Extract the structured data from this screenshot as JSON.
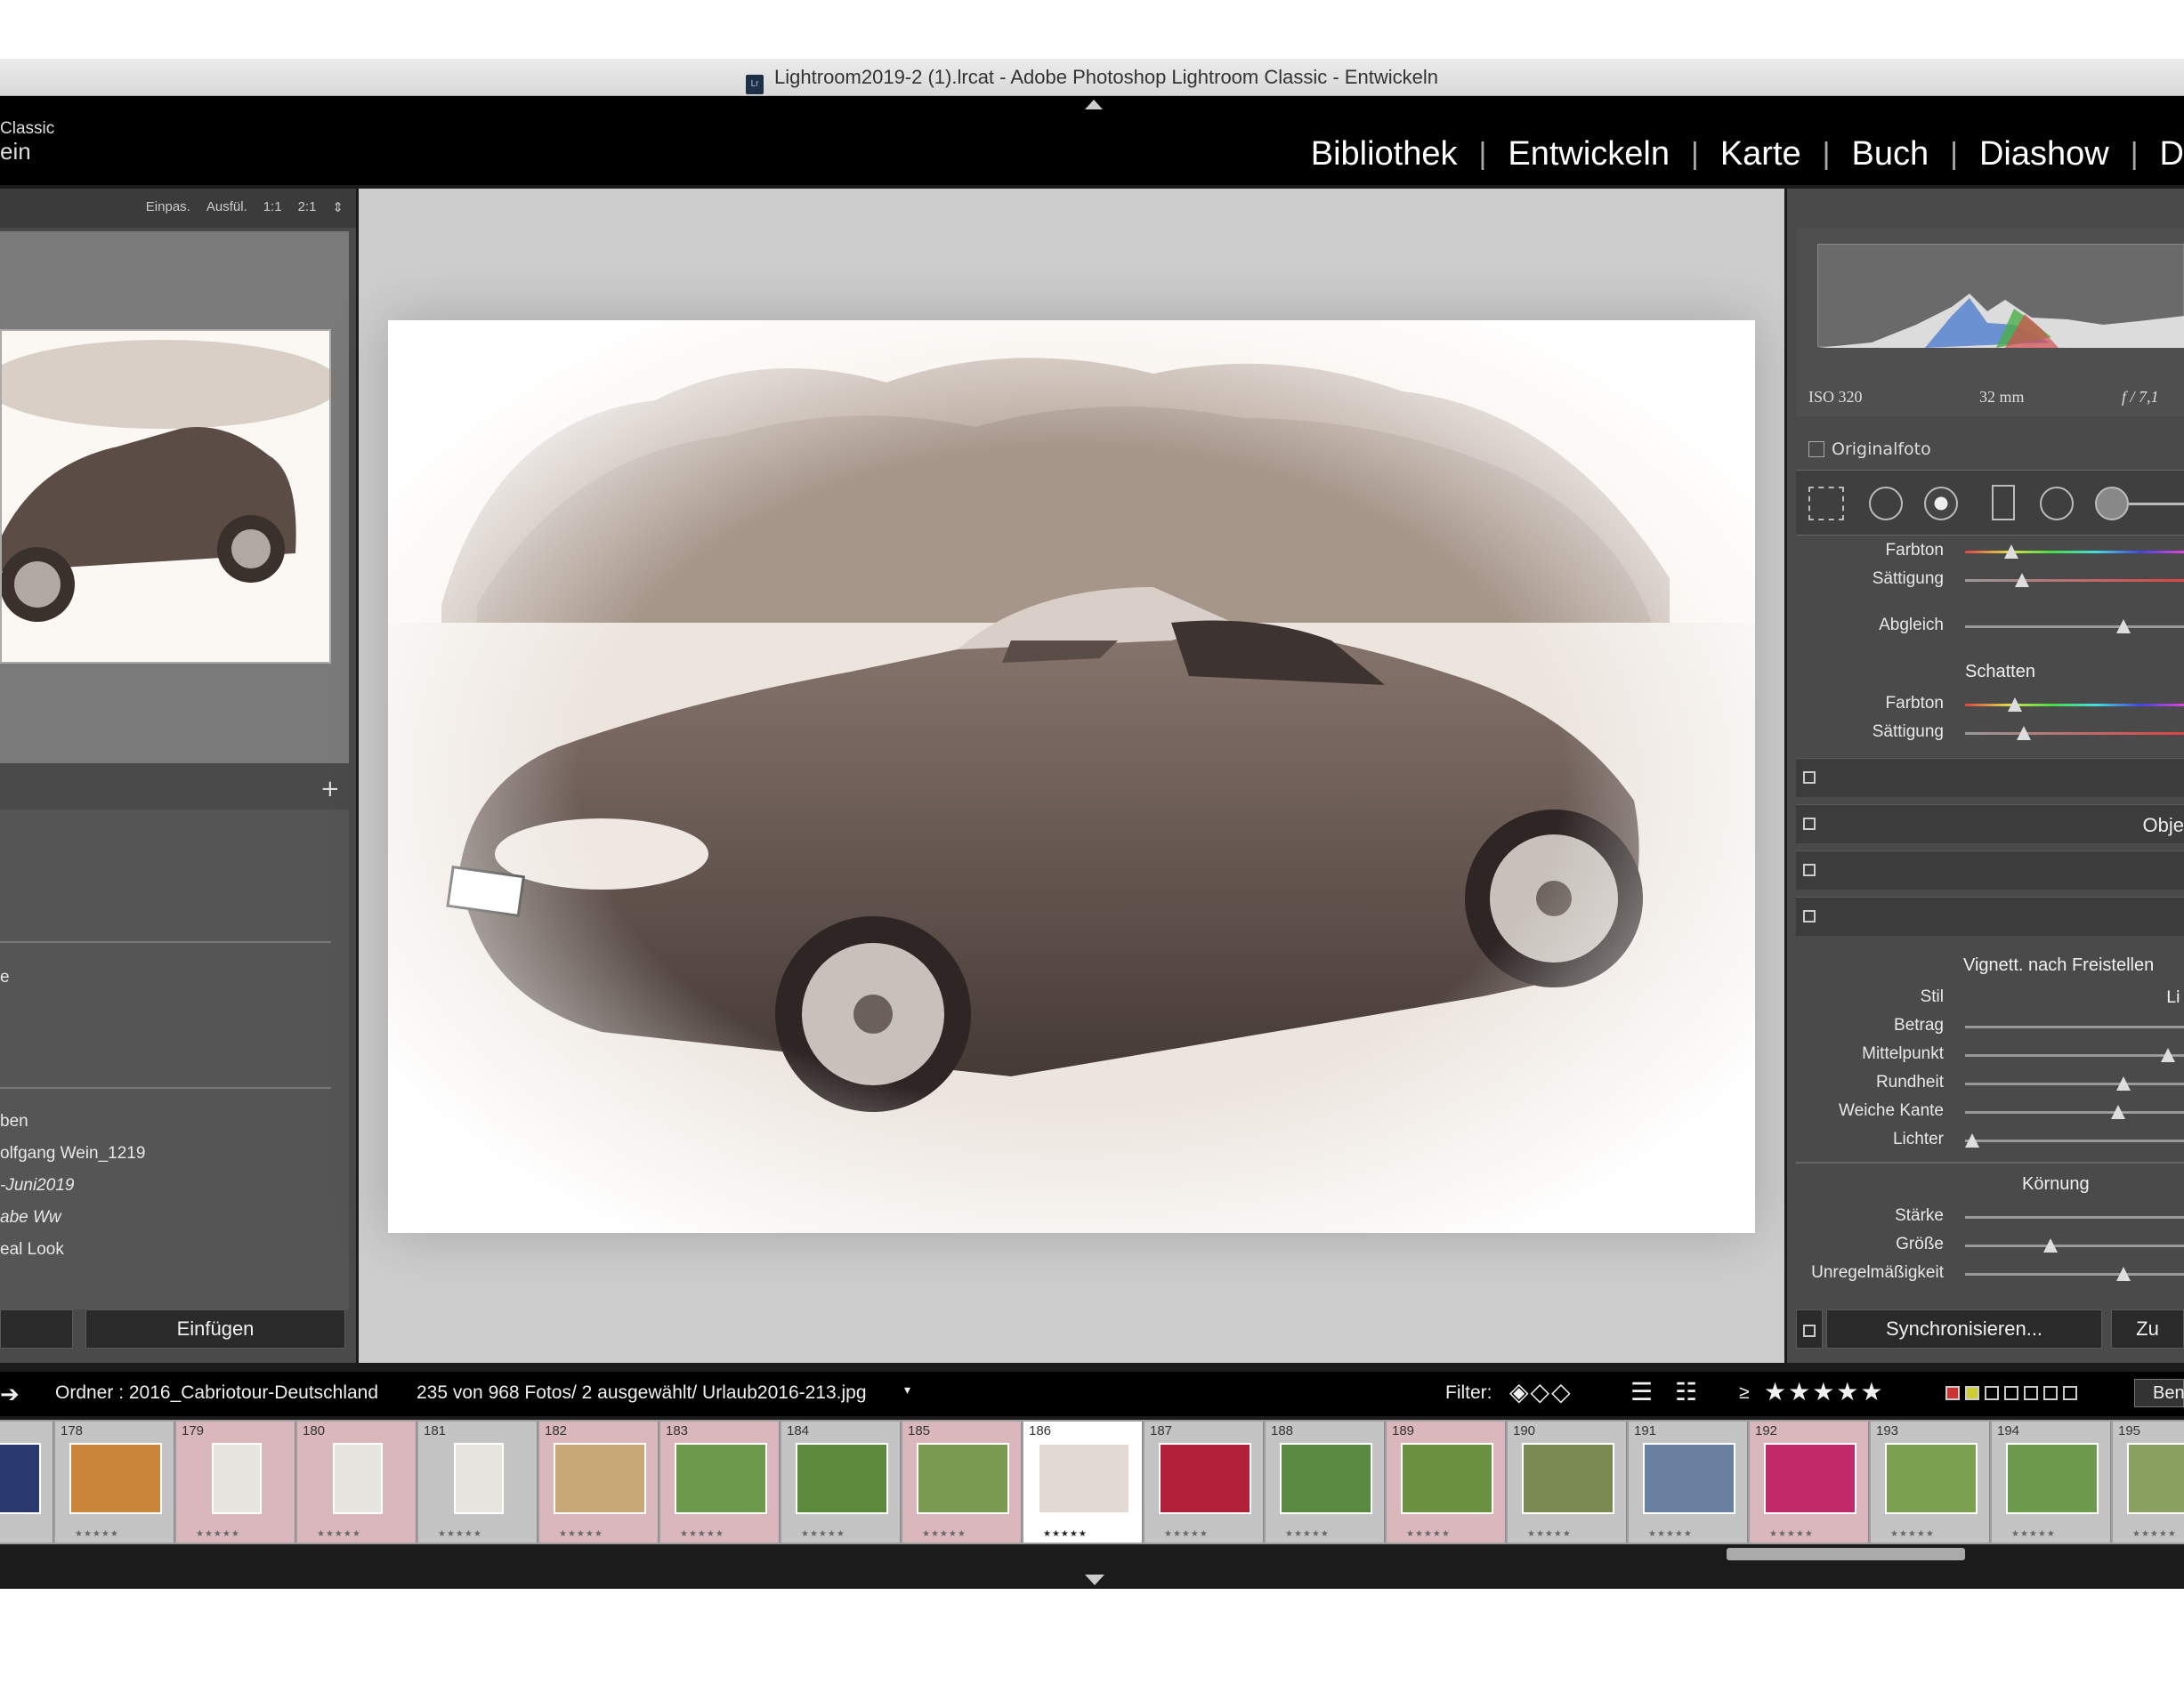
{
  "window": {
    "title": "Lightroom2019-2 (1).lrcat - Adobe Photoshop Lightroom Classic - Entwickeln",
    "badge": "Lr"
  },
  "identity": {
    "line1": "Classic",
    "line2": "ein"
  },
  "modules": [
    "Bibliothek",
    "Entwickeln",
    "Karte",
    "Buch",
    "Diashow",
    "D"
  ],
  "navigator": {
    "zoom_options": [
      "Einpas.",
      "Ausfül.",
      "1:1",
      "2:1"
    ],
    "add_symbol": "+"
  },
  "left_panel": {
    "partial_items": [
      "e",
      "ben",
      "olfgang Wein_1219",
      "-Juni2019",
      "abe Ww",
      "eal Look"
    ],
    "copy_button": "",
    "paste_button": "Einfügen"
  },
  "histogram": {
    "iso": "ISO 320",
    "focal": "32 mm",
    "aperture": "f / 7,1",
    "original_label": "Originalfoto"
  },
  "split_toning": {
    "highlights": [
      {
        "label": "Farbton"
      },
      {
        "label": "Sättigung"
      }
    ],
    "balance": "Abgleich",
    "shadows_title": "Schatten",
    "shadows": [
      {
        "label": "Farbton"
      },
      {
        "label": "Sättigung"
      }
    ]
  },
  "collapsed_panels": [
    "",
    "Obje",
    "",
    ""
  ],
  "effects": {
    "vignette_title": "Vignett. nach Freistellen",
    "vignette_rows": [
      {
        "label": "Stil",
        "value": "Li"
      },
      {
        "label": "Betrag",
        "value": ""
      },
      {
        "label": "Mittelpunkt",
        "value": ""
      },
      {
        "label": "Rundheit",
        "value": ""
      },
      {
        "label": "Weiche Kante",
        "value": ""
      },
      {
        "label": "Lichter",
        "value": ""
      }
    ],
    "grain_title": "Körnung",
    "grain_rows": [
      {
        "label": "Stärke"
      },
      {
        "label": "Größe"
      },
      {
        "label": "Unregelmäßigkeit"
      }
    ]
  },
  "bottom_buttons": {
    "sync": "Synchronisieren...",
    "reset": "Zu"
  },
  "filmstrip": {
    "source": "Ordner : 2016_Cabriotour-Deutschland",
    "info": "235 von 968 Fotos/ 2 ausgewählt/ Urlaub2016-213.jpg",
    "filter_label": "Filter:",
    "rating_prefix": "≥",
    "rating_stars": "★★★★★",
    "right_label": "Ben",
    "frames": [
      {
        "num": ""
      },
      {
        "num": "178"
      },
      {
        "num": "179"
      },
      {
        "num": "180"
      },
      {
        "num": "181"
      },
      {
        "num": "182"
      },
      {
        "num": "183"
      },
      {
        "num": "184"
      },
      {
        "num": "185"
      },
      {
        "num": "186"
      },
      {
        "num": "187"
      },
      {
        "num": "188"
      },
      {
        "num": "189"
      },
      {
        "num": "190"
      },
      {
        "num": "191"
      },
      {
        "num": "192"
      },
      {
        "num": "193"
      },
      {
        "num": "194"
      },
      {
        "num": "195"
      }
    ]
  },
  "colors": {
    "accent_select": "#d9b7bc",
    "panel_bg": "#4a4a4a",
    "photo_tone": "#6b5a52"
  }
}
